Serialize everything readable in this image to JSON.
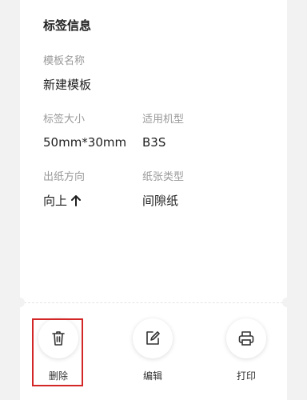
{
  "label_info": {
    "section_title": "标签信息",
    "template_name_label": "模板名称",
    "template_name_value": "新建模板",
    "label_size_label": "标签大小",
    "label_size_value": "50mm*30mm",
    "model_label": "适用机型",
    "model_value": "B3S",
    "paper_direction_label": "出纸方向",
    "paper_direction_value": "向上",
    "paper_direction_icon": "arrow-up-icon",
    "paper_type_label": "纸张类型",
    "paper_type_value": "间隙纸"
  },
  "actions": [
    {
      "label": "删除",
      "icon": "trash-icon"
    },
    {
      "label": "编辑",
      "icon": "edit-icon"
    },
    {
      "label": "打印",
      "icon": "printer-icon"
    }
  ],
  "colors": {
    "highlight": "#d32727"
  }
}
